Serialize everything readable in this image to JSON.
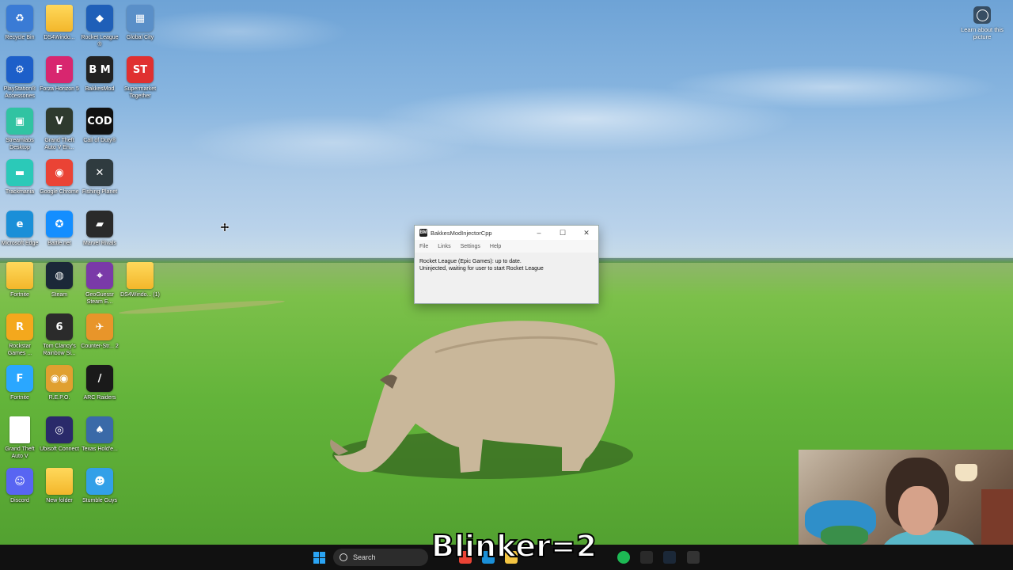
{
  "desktop": {
    "icons": [
      {
        "label": "Recycle Bin",
        "glyph": "♻",
        "color": "#3a7bd5"
      },
      {
        "label": "DS4Windo...",
        "glyph": "",
        "color": "folder"
      },
      {
        "label": "Rocket League ®",
        "glyph": "◆",
        "color": "#1f5fb8"
      },
      {
        "label": "Global City",
        "glyph": "▦",
        "color": "#5a8fc8"
      },
      {
        "label": "PlayStation® Accessories",
        "glyph": "⚙",
        "color": "#1d5fc9"
      },
      {
        "label": "Forza Horizon 5",
        "glyph": "F",
        "color": "#d8266f"
      },
      {
        "label": "BakkesMod",
        "glyph": "B M",
        "color": "#222222"
      },
      {
        "label": "Supermarket Together",
        "glyph": "ST",
        "color": "#e03030"
      },
      {
        "label": "Streamlabs Desktop",
        "glyph": "▣",
        "color": "#31c3a2"
      },
      {
        "label": "Grand Theft Auto V En...",
        "glyph": "V",
        "color": "#2e3a2e"
      },
      {
        "label": "Call of Duty®",
        "glyph": "COD",
        "color": "#111111"
      },
      {
        "label": "Trackmania",
        "glyph": "▬",
        "color": "#2bc9b8"
      },
      {
        "label": "Google Chrome",
        "glyph": "◉",
        "color": "#ea4335"
      },
      {
        "label": "Fishing Planet",
        "glyph": "✕",
        "color": "#2f3b3f"
      },
      {
        "label": "Microsoft Edge",
        "glyph": "e",
        "color": "#1a8fd8"
      },
      {
        "label": "Battle.net",
        "glyph": "✪",
        "color": "#148eff"
      },
      {
        "label": "Marvel Rivals",
        "glyph": "▰",
        "color": "#2a2a2a"
      },
      {
        "label": "Fortnite",
        "glyph": "",
        "color": "folder"
      },
      {
        "label": "Steam",
        "glyph": "◍",
        "color": "#1b2838"
      },
      {
        "label": "GeoGuessr Steam E...",
        "glyph": "⌖",
        "color": "#7a3aa8"
      },
      {
        "label": "DS4Windo... (1)",
        "glyph": "",
        "color": "folder"
      },
      {
        "label": "Rockstar Games ...",
        "glyph": "R",
        "color": "#f4a81d"
      },
      {
        "label": "Tom Clancy's Rainbow Si...",
        "glyph": "6",
        "color": "#2b2b2b"
      },
      {
        "label": "Counter-Str... 2",
        "glyph": "✈",
        "color": "#e8952a"
      },
      {
        "label": "Fortnite",
        "glyph": "F",
        "color": "#2aa7ff"
      },
      {
        "label": "R.E.P.O.",
        "glyph": "◉◉",
        "color": "#e0a030"
      },
      {
        "label": "ARC Raiders",
        "glyph": "/",
        "color": "#1a1a1a"
      },
      {
        "label": "Grand Theft Auto V",
        "glyph": "",
        "color": "doc"
      },
      {
        "label": "Ubisoft Connect",
        "glyph": "◎",
        "color": "#2a2a6a"
      },
      {
        "label": "Texas Hold'e...",
        "glyph": "♠",
        "color": "#3a6aa8"
      },
      {
        "label": "Discord",
        "glyph": "☺",
        "color": "#5865f2"
      },
      {
        "label": "New folder",
        "glyph": "",
        "color": "folder"
      },
      {
        "label": "Stumble Guys",
        "glyph": "☻",
        "color": "#32a0e8"
      }
    ],
    "learn_about": "Learn about this picture"
  },
  "window": {
    "title": "BakkesModInjectorCpp",
    "app_icon": "BM",
    "menu": [
      "File",
      "Links",
      "Settings",
      "Help"
    ],
    "status_line1": "Rocket League (Epic Games): up to date.",
    "status_line2": "Uninjected, waiting for user to start Rocket League",
    "minimize": "–",
    "maximize": "☐",
    "close": "✕"
  },
  "taskbar": {
    "search_placeholder": "Search",
    "apps": [
      {
        "name": "chrome",
        "color": "#ea4335"
      },
      {
        "name": "edge",
        "color": "#1a8fd8"
      },
      {
        "name": "explorer",
        "color": "#f4c542"
      },
      {
        "name": "spotify",
        "color": "#1db954"
      },
      {
        "name": "epic",
        "color": "#2a2a2a"
      },
      {
        "name": "steam",
        "color": "#1b2838"
      },
      {
        "name": "bakkesmod",
        "color": "#333333"
      }
    ]
  },
  "overlay": {
    "text": "Blinker=2"
  }
}
